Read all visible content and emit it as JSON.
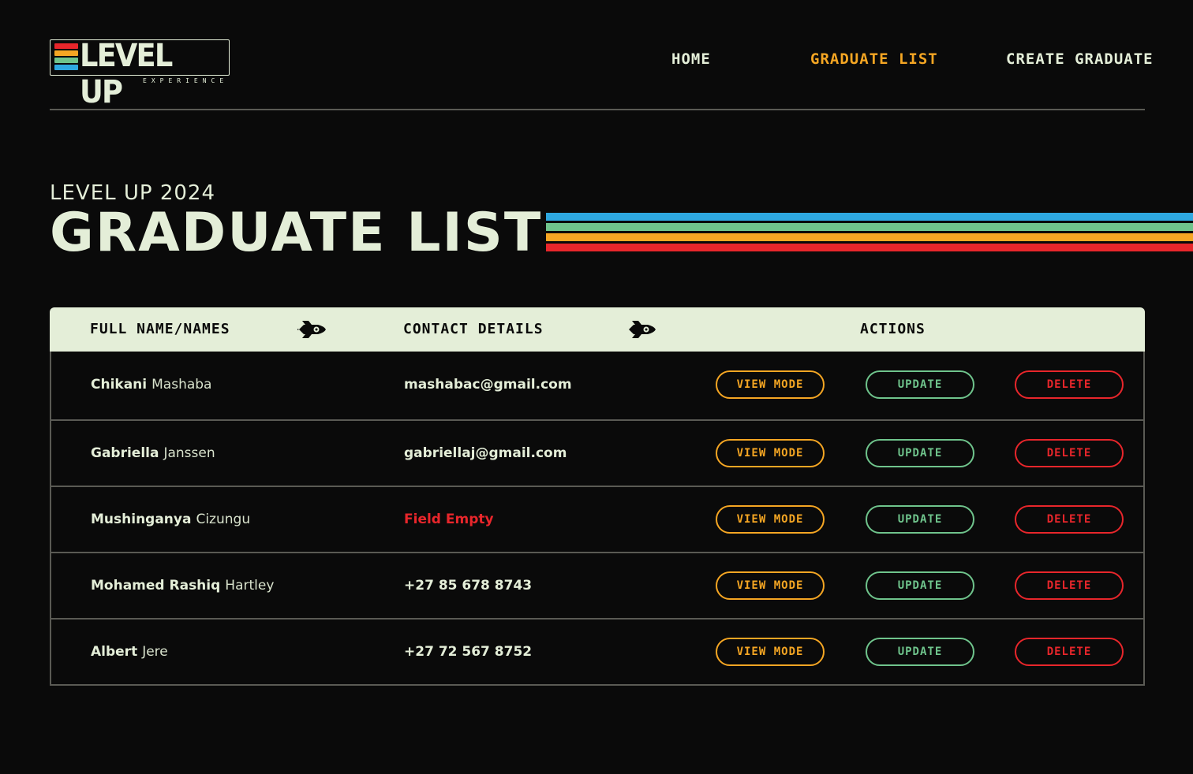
{
  "header": {
    "logo_text": "LEVEL UP",
    "logo_sub": "EXPERIENCE",
    "nav": [
      {
        "label": "HOME",
        "active": false
      },
      {
        "label": "GRADUATE LIST",
        "active": true
      },
      {
        "label": "CREATE GRADUATE",
        "active": false
      }
    ]
  },
  "hero": {
    "subtitle": "LEVEL UP 2024",
    "title": "GRADUATE LIST"
  },
  "colors": {
    "accent_orange": "#f5a623",
    "accent_green": "#6fc48c",
    "accent_red": "#e8262b",
    "accent_blue": "#2ea8e0",
    "cream": "#e4eed8",
    "background": "#0a0a0a"
  },
  "table": {
    "columns": {
      "name": "FULL NAME/NAMES",
      "contact": "CONTACT DETAILS",
      "actions": "ACTIONS"
    },
    "sort_icon": "rocket-icon",
    "actions": {
      "view": "VIEW MODE",
      "update": "UPDATE",
      "delete": "DELETE"
    },
    "rows": [
      {
        "first": "Chikani",
        "last": "Mashaba",
        "contact": "mashabac@gmail.com"
      },
      {
        "first": "Gabriella",
        "last": "Janssen",
        "contact": "gabriellaj@gmail.com"
      },
      {
        "first": "Mushinganya",
        "last": "Cizungu",
        "contact": "Field Empty"
      },
      {
        "first": "Mohamed Rashiq",
        "last": "Hartley",
        "contact": "+27 85 678 8743"
      },
      {
        "first": "Albert",
        "last": "Jere",
        "contact": "+27 72 567 8752"
      }
    ]
  }
}
